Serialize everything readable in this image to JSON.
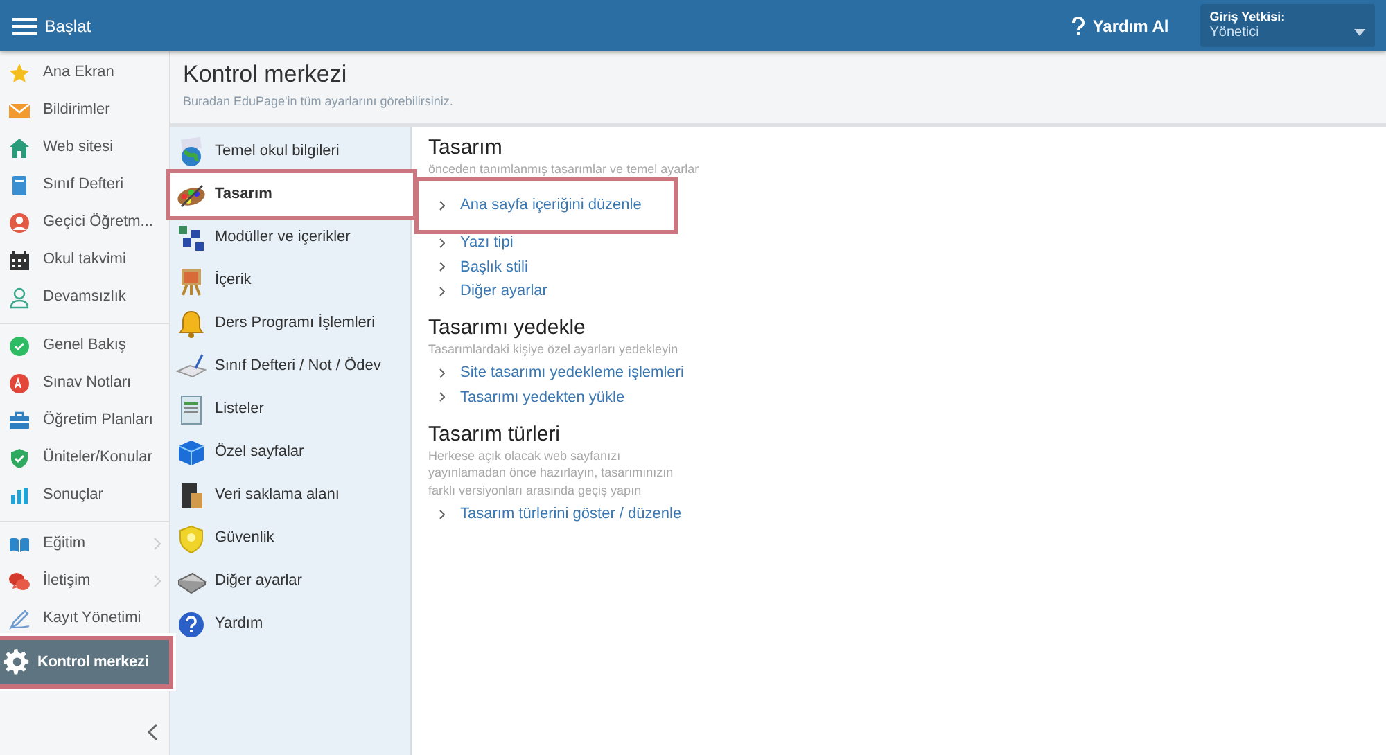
{
  "topbar": {
    "menu_label": "Başlat",
    "help_label": "Yardım Al",
    "role": {
      "label": "Giriş Yetkisi:",
      "value": "Yönetici"
    }
  },
  "sidebar": {
    "groups": [
      {
        "items": [
          {
            "label": "Ana Ekran",
            "selected": false,
            "submenu": false
          },
          {
            "label": "Bildirimler",
            "selected": false,
            "submenu": false
          },
          {
            "label": "Web sitesi",
            "selected": false,
            "submenu": false
          },
          {
            "label": "Sınıf Defteri",
            "selected": false,
            "submenu": false
          },
          {
            "label": "Geçici Öğretm...",
            "selected": false,
            "submenu": false
          },
          {
            "label": "Okul takvimi",
            "selected": false,
            "submenu": false
          },
          {
            "label": "Devamsızlık",
            "selected": false,
            "submenu": false
          }
        ]
      },
      {
        "items": [
          {
            "label": "Genel Bakış",
            "selected": false,
            "submenu": false
          },
          {
            "label": "Sınav Notları",
            "selected": false,
            "submenu": false
          },
          {
            "label": "Öğretim Planları",
            "selected": false,
            "submenu": false
          },
          {
            "label": "Üniteler/Konular",
            "selected": false,
            "submenu": false
          },
          {
            "label": "Sonuçlar",
            "selected": false,
            "submenu": false
          }
        ]
      },
      {
        "items": [
          {
            "label": "Eğitim",
            "selected": false,
            "submenu": true
          },
          {
            "label": "İletişim",
            "selected": false,
            "submenu": true
          },
          {
            "label": "Kayıt Yönetimi",
            "selected": false,
            "submenu": false
          },
          {
            "label": "Kontrol merkezi",
            "selected": true,
            "submenu": false
          }
        ]
      }
    ]
  },
  "page": {
    "title": "Kontrol merkezi",
    "subtitle": "Buradan EduPage'in tüm ayarlarını görebilirsiniz."
  },
  "categories": [
    {
      "label": "Temel okul bilgileri",
      "selected": false
    },
    {
      "label": "Tasarım",
      "selected": true
    },
    {
      "label": "Modüller ve içerikler",
      "selected": false
    },
    {
      "label": "İçerik",
      "selected": false
    },
    {
      "label": "Ders Programı İşlemleri",
      "selected": false
    },
    {
      "label": "Sınıf Defteri / Not / Ödev",
      "selected": false
    },
    {
      "label": "Listeler",
      "selected": false
    },
    {
      "label": "Özel sayfalar",
      "selected": false
    },
    {
      "label": "Veri saklama alanı",
      "selected": false
    },
    {
      "label": "Güvenlik",
      "selected": false
    },
    {
      "label": "Diğer ayarlar",
      "selected": false
    },
    {
      "label": "Yardım",
      "selected": false
    }
  ],
  "sections": [
    {
      "title": "Tasarım",
      "description": "önceden tanımlanmış tasarımlar ve temel ayarlar",
      "links": [
        {
          "label": "Ana sayfa içeriğini düzenle",
          "highlighted": true
        },
        {
          "label": "Yazı tipi",
          "highlighted": false
        },
        {
          "label": "Başlık stili",
          "highlighted": false
        },
        {
          "label": "Diğer ayarlar",
          "highlighted": false
        }
      ]
    },
    {
      "title": "Tasarımı yedekle",
      "description": "Tasarımlardaki kişiye özel ayarları yedekleyin",
      "links": [
        {
          "label": "Site tasarımı yedekleme işlemleri",
          "highlighted": false
        },
        {
          "label": "Tasarımı yedekten yükle",
          "highlighted": false
        }
      ]
    },
    {
      "title": "Tasarım türleri",
      "description": "Herkese açık olacak web sayfanızı yayınlamadan önce hazırlayın, tasarımınızın farklı versiyonları arasında geçiş yapın",
      "links": [
        {
          "label": "Tasarım türlerini göster / düzenle",
          "highlighted": false
        }
      ]
    }
  ]
}
